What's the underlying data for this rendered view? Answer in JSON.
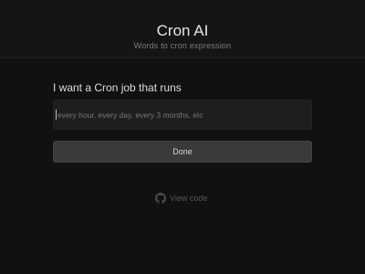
{
  "header": {
    "title": "Cron AI",
    "subtitle": "Words to cron expression"
  },
  "form": {
    "label": "I want a Cron job that runs",
    "input_value": "",
    "input_placeholder": "every hour, every day, every 3 months, etc",
    "done_label": "Done"
  },
  "footer": {
    "view_code_label": "View code",
    "icon": "github-icon"
  },
  "colors": {
    "background": "#111111",
    "header_background": "#151515",
    "input_background": "#1e1e1e",
    "button_background": "#3a3a3a",
    "muted_text": "#555555"
  }
}
